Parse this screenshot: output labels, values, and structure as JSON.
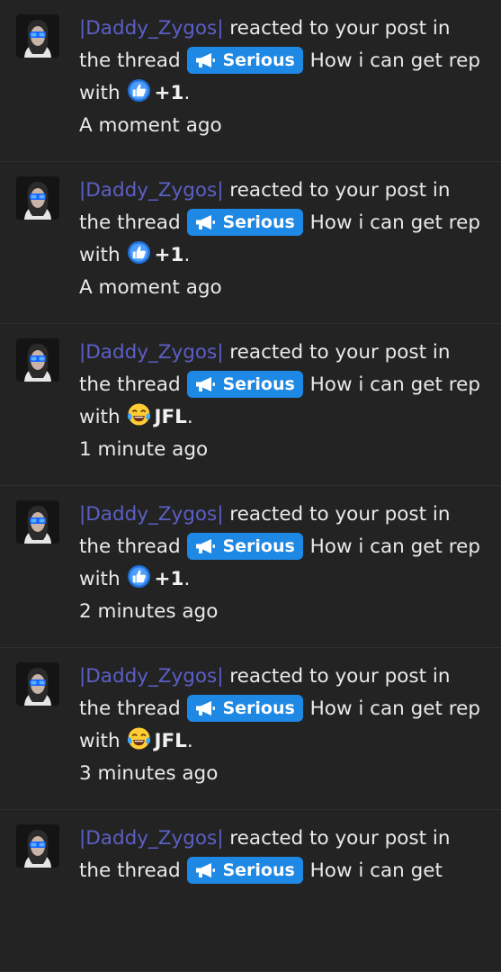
{
  "alerts": [
    {
      "username": "|Daddy_Zygos|",
      "action": "reacted to your post in the thread",
      "prefix": "Serious",
      "thread_title": "How i can get rep with",
      "reaction": "+1",
      "reaction_icon": "thumbs-up-icon",
      "time": "A moment ago"
    },
    {
      "username": "|Daddy_Zygos|",
      "action": "reacted to your post in the thread",
      "prefix": "Serious",
      "thread_title": "How i can get rep with",
      "reaction": "+1",
      "reaction_icon": "thumbs-up-icon",
      "time": "A moment ago"
    },
    {
      "username": "|Daddy_Zygos|",
      "action": "reacted to your post in the thread",
      "prefix": "Serious",
      "thread_title": "How i can get rep with",
      "reaction": "JFL",
      "reaction_icon": "tears-of-joy-icon",
      "time": "1 minute ago"
    },
    {
      "username": "|Daddy_Zygos|",
      "action": "reacted to your post in the thread",
      "prefix": "Serious",
      "thread_title": "How i can get rep with",
      "reaction": "+1",
      "reaction_icon": "thumbs-up-icon",
      "time": "2 minutes ago"
    },
    {
      "username": "|Daddy_Zygos|",
      "action": "reacted to your post in the thread",
      "prefix": "Serious",
      "thread_title": "How i can get rep with",
      "reaction": "JFL",
      "reaction_icon": "tears-of-joy-icon",
      "time": "3 minutes ago"
    },
    {
      "username": "|Daddy_Zygos|",
      "action": "reacted to your post in the thread",
      "prefix": "Serious",
      "thread_title": "How i can get",
      "time": ""
    }
  ],
  "colors": {
    "background": "#232323",
    "username": "#5b5fc7",
    "prefix_badge": "#1e88e5",
    "text": "#e9e9e9"
  }
}
